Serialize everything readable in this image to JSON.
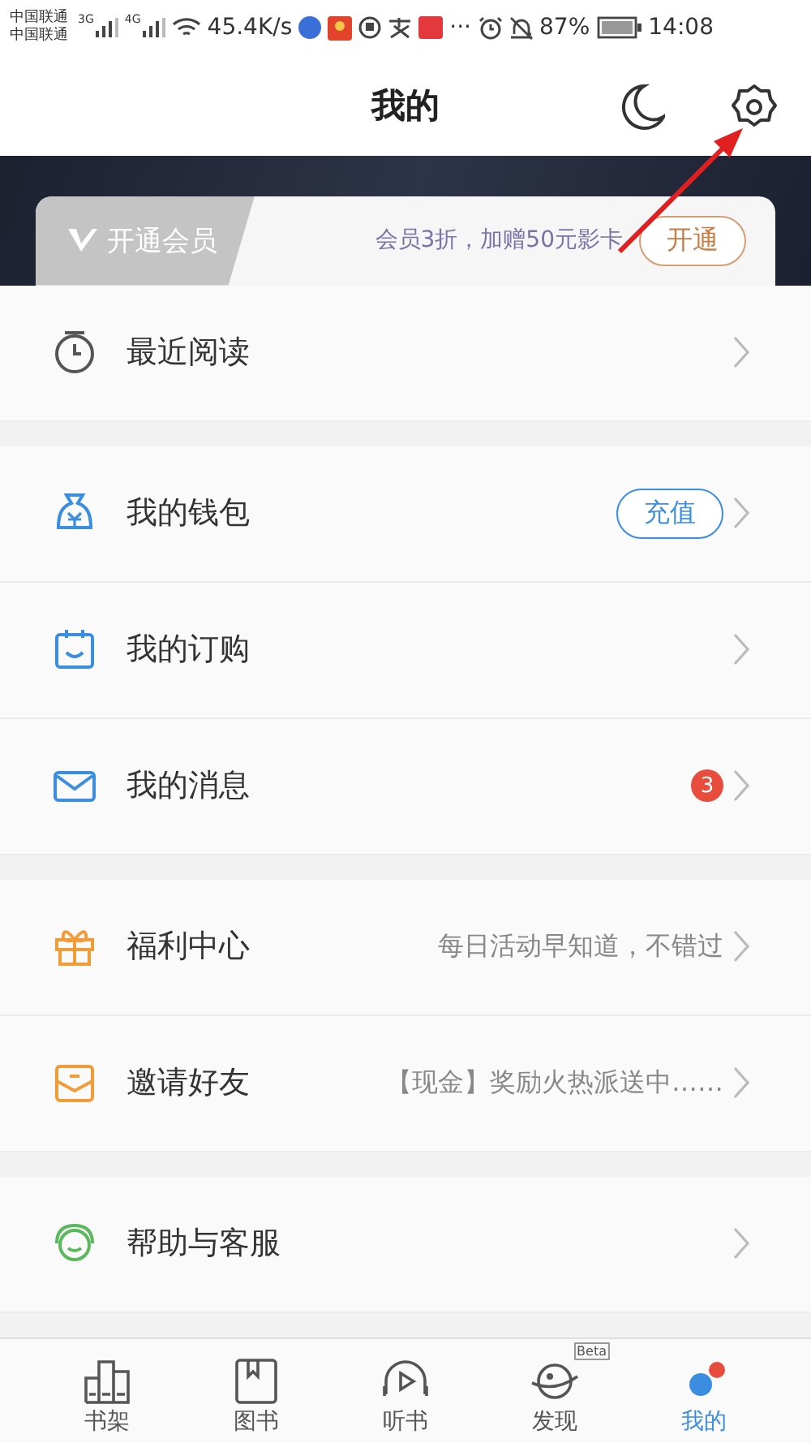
{
  "status_bar": {
    "carriers": [
      "中国联通",
      "中国联通"
    ],
    "networks": [
      "3G",
      "4G"
    ],
    "speed": "45.4K/s",
    "more": "···",
    "battery": "87%",
    "time": "14:08"
  },
  "header": {
    "title": "我的"
  },
  "vip": {
    "label": "开通会员",
    "promo": "会员3折，加赠50元影卡",
    "button": "开通"
  },
  "sections": [
    [
      {
        "label": "最近阅读"
      }
    ],
    [
      {
        "label": "我的钱包",
        "action": "充值"
      },
      {
        "label": "我的订购"
      },
      {
        "label": "我的消息",
        "badge": "3"
      }
    ],
    [
      {
        "label": "福利中心",
        "hint": "每日活动早知道，不错过"
      },
      {
        "label": "邀请好友",
        "hint": "【现金】奖励火热派送中……"
      }
    ],
    [
      {
        "label": "帮助与客服"
      }
    ]
  ],
  "nav": [
    {
      "label": "书架",
      "selected": false
    },
    {
      "label": "图书",
      "selected": false
    },
    {
      "label": "听书",
      "selected": false
    },
    {
      "label": "发现",
      "selected": false,
      "tag": "Beta"
    },
    {
      "label": "我的",
      "selected": true
    }
  ]
}
